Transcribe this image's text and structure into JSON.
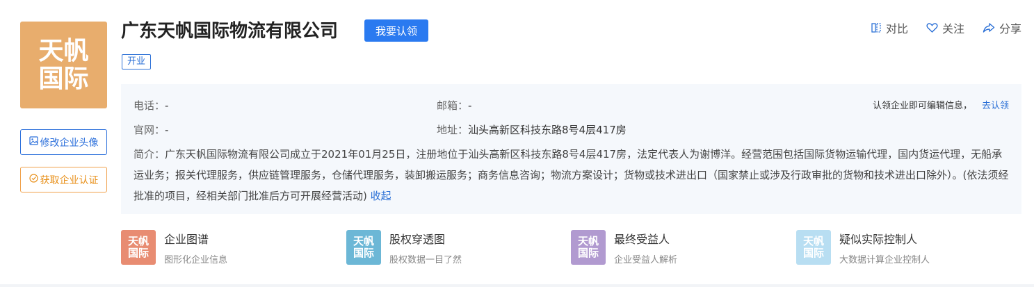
{
  "logo": {
    "text": "天帆国际",
    "color": "#e8ad6d"
  },
  "side_buttons": {
    "edit_avatar": "修改企业头像",
    "get_cert": "获取企业认证"
  },
  "company": {
    "name": "广东天帆国际物流有限公司",
    "claim_button": "我要认领",
    "status": "开业"
  },
  "top_actions": {
    "compare": "对比",
    "follow": "关注",
    "share": "分享"
  },
  "info": {
    "phone_label": "电话：",
    "phone_value": "-",
    "email_label": "邮箱：",
    "email_value": "-",
    "website_label": "官网：",
    "website_value": "-",
    "address_label": "地址：",
    "address_value": "汕头高新区科技东路8号4层417房",
    "claim_hint": "认领企业即可编辑信息，",
    "claim_link": "去认领",
    "intro_label": "简介：",
    "intro_text": "广东天帆国际物流有限公司成立于2021年01月25日，注册地位于汕头高新区科技东路8号4层417房，法定代表人为谢博洋。经营范围包括国际货物运输代理，国内货运代理，无船承运业务；报关代理服务，供应链管理服务，仓储代理服务，装卸搬运服务；商务信息咨询；物流方案设计；货物或技术进出口（国家禁止或涉及行政审批的货物和技术进出口除外）。(依法须经批准的项目，经相关部门批准后方可开展经营活动)",
    "collapse_link": "收起"
  },
  "cards": [
    {
      "logo_text": "天帆国际",
      "title": "企业图谱",
      "subtitle": "图形化企业信息",
      "color": "#e88c72"
    },
    {
      "logo_text": "天帆国际",
      "title": "股权穿透图",
      "subtitle": "股权数据一目了然",
      "color": "#6cb7d6"
    },
    {
      "logo_text": "天帆国际",
      "title": "最终受益人",
      "subtitle": "企业受益人解析",
      "color": "#b19ad0"
    },
    {
      "logo_text": "天帆国际",
      "title": "疑似实际控制人",
      "subtitle": "大数据计算企业控制人",
      "color": "#b8def2"
    }
  ],
  "colors": {
    "accent": "#2a7af0",
    "link": "#2a6fd6",
    "orange": "#e8901a"
  }
}
